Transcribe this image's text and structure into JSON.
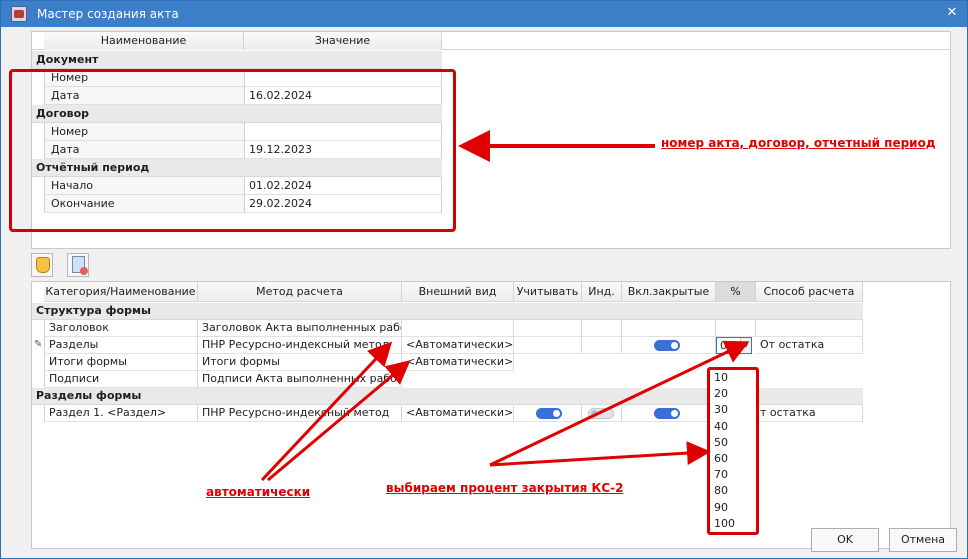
{
  "window": {
    "title": "Мастер создания акта"
  },
  "property_grid": {
    "columns": [
      "Наименование",
      "Значение"
    ],
    "groups": [
      {
        "title": "Документ",
        "rows": [
          {
            "name": "Номер",
            "value": ""
          },
          {
            "name": "Дата",
            "value": "16.02.2024"
          }
        ]
      },
      {
        "title": "Договор",
        "rows": [
          {
            "name": "Номер",
            "value": ""
          },
          {
            "name": "Дата",
            "value": "19.12.2023"
          }
        ]
      },
      {
        "title": "Отчётный период",
        "rows": [
          {
            "name": "Начало",
            "value": "01.02.2024"
          },
          {
            "name": "Окончание",
            "value": "29.02.2024"
          }
        ]
      }
    ]
  },
  "form_grid": {
    "columns": [
      "Категория/Наименование",
      "Метод расчета",
      "Внешний вид",
      "Учитывать",
      "Инд.",
      "Вкл.закрытые",
      "%",
      "Способ расчета"
    ],
    "group1": {
      "title": "Структура формы",
      "rows": [
        {
          "name": "Заголовок",
          "method": "Заголовок Акта выполненных работ",
          "view": ""
        },
        {
          "name": "Разделы",
          "method": "ПНР Ресурсно-индексный метод",
          "view": "<Автоматически>",
          "percent": "0",
          "calc": "От остатка"
        },
        {
          "name": "Итоги формы",
          "method": "Итоги формы",
          "view": "<Автоматически>"
        },
        {
          "name": "Подписи",
          "method": "Подписи Акта выполненных работ",
          "view": ""
        }
      ]
    },
    "group2": {
      "title": "Разделы формы",
      "rows": [
        {
          "name": "Раздел 1. <Раздел>",
          "method": "ПНР Ресурсно-индексный метод",
          "view": "<Автоматически>",
          "calc": "т остатка"
        }
      ]
    }
  },
  "percent_options": [
    "10",
    "20",
    "30",
    "40",
    "50",
    "60",
    "70",
    "80",
    "90",
    "100"
  ],
  "annotations": {
    "top": "номер акта, договор, отчетный период",
    "auto": "автоматически",
    "percent": "выбираем процент закрытия КС-2"
  },
  "buttons": {
    "ok": "OK",
    "cancel": "Отмена"
  },
  "colors": {
    "annotation": "#e00000",
    "toggle_on": "#3a6fd8",
    "titlebar": "#3c7fc8"
  }
}
